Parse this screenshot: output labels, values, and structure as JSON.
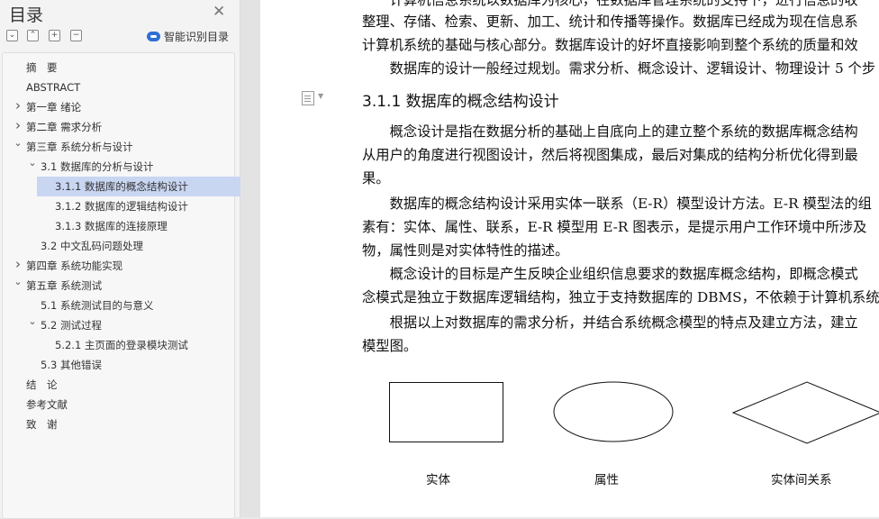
{
  "sidebar": {
    "title": "目录",
    "close_icon": "close-icon",
    "toolbar_icons": [
      "collapse-all-icon",
      "expand-up-icon",
      "expand-all-icon",
      "collapse-minus-icon"
    ],
    "smart_toc_label": "智能识别目录",
    "toc": [
      {
        "label": "摘　要",
        "level": 1,
        "has_children": false,
        "expanded": false,
        "selected": false
      },
      {
        "label": "ABSTRACT",
        "level": 1,
        "has_children": false,
        "expanded": false,
        "selected": false
      },
      {
        "label": "第一章  绪论",
        "level": 1,
        "has_children": true,
        "expanded": false,
        "selected": false
      },
      {
        "label": "第二章  需求分析",
        "level": 1,
        "has_children": true,
        "expanded": false,
        "selected": false
      },
      {
        "label": "第三章  系统分析与设计",
        "level": 1,
        "has_children": true,
        "expanded": true,
        "selected": false
      },
      {
        "label": "3.1 数据库的分析与设计",
        "level": 2,
        "has_children": true,
        "expanded": true,
        "selected": false
      },
      {
        "label": "3.1.1 数据库的概念结构设计",
        "level": 3,
        "has_children": false,
        "expanded": false,
        "selected": true
      },
      {
        "label": "3.1.2 数据库的逻辑结构设计",
        "level": 3,
        "has_children": false,
        "expanded": false,
        "selected": false
      },
      {
        "label": "3.1.3 数据库的连接原理",
        "level": 3,
        "has_children": false,
        "expanded": false,
        "selected": false
      },
      {
        "label": "3.2 中文乱码问题处理",
        "level": 2,
        "has_children": false,
        "expanded": false,
        "selected": false
      },
      {
        "label": "第四章  系统功能实现",
        "level": 1,
        "has_children": true,
        "expanded": false,
        "selected": false
      },
      {
        "label": "第五章  系统测试",
        "level": 1,
        "has_children": true,
        "expanded": true,
        "selected": false
      },
      {
        "label": "5.1 系统测试目的与意义",
        "level": 2,
        "has_children": false,
        "expanded": false,
        "selected": false
      },
      {
        "label": "5.2 测试过程",
        "level": 2,
        "has_children": true,
        "expanded": true,
        "selected": false
      },
      {
        "label": "5.2.1 主页面的登录模块测试",
        "level": 3,
        "has_children": false,
        "expanded": false,
        "selected": false
      },
      {
        "label": "5.3 其他错误",
        "level": 2,
        "has_children": false,
        "expanded": false,
        "selected": false
      },
      {
        "label": "结　论",
        "level": 1,
        "has_children": false,
        "expanded": false,
        "selected": false
      },
      {
        "label": "参考文献",
        "level": 1,
        "has_children": false,
        "expanded": false,
        "selected": false
      },
      {
        "label": "致　谢",
        "level": 1,
        "has_children": false,
        "expanded": false,
        "selected": false
      }
    ]
  },
  "document": {
    "paragraph_icon": "paragraph-mark-icon",
    "lines": [
      "　　计算机信息系统以数据库为核心，在数据库管理系统的支持下，进行信息的收",
      "整理、存储、检索、更新、加工、统计和传播等操作。数据库已经成为现在信息系",
      "计算机系统的基础与核心部分。数据库设计的好坏直接影响到整个系统的质量和效",
      "　　数据库的设计一般经过规划。需求分析、概念设计、逻辑设计、物理设计 5 个步"
    ],
    "heading": "3.1.1 数据库的概念结构设计",
    "body_lines": [
      "　　概念设计是指在数据分析的基础上自底向上的建立整个系统的数据库概念结构",
      "从用户的角度进行视图设计，然后将视图集成，最后对集成的结构分析优化得到最",
      "果。",
      "　　数据库的概念结构设计采用实体一联系（E-R）模型设计方法。E-R 模型法的组",
      "素有：实体、属性、联系，E-R 模型用 E-R 图表示，是提示用户工作环境中所涉及",
      "物，属性则是对实体特性的描述。",
      "　　概念设计的目标是产生反映企业组织信息要求的数据库概念结构，即概念模式",
      "念模式是独立于数据库逻辑结构，独立于支持数据库的 DBMS，不依赖于计算机系统",
      "　　根据以上对数据库的需求分析，并结合系统概念模型的特点及建立方法，建立",
      "模型图。"
    ],
    "figure": {
      "labels": [
        "实体",
        "属性",
        "实体间关系"
      ]
    }
  }
}
